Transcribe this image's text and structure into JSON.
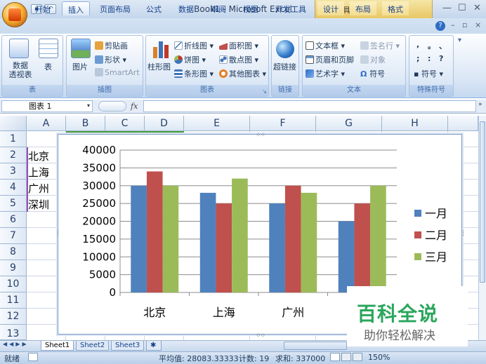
{
  "title_bar": {
    "app_title": "Book1 - Microsoft Excel",
    "context_tab_title": "图表工具",
    "quick_access": [
      "save",
      "undo",
      "redo"
    ]
  },
  "ribbon_tabs": [
    "开始",
    "插入",
    "页面布局",
    "公式",
    "数据",
    "审阅",
    "视图",
    "开发工具",
    "设计",
    "布局",
    "格式"
  ],
  "active_tab": "插入",
  "ribbon": {
    "table_group": {
      "label": "表",
      "pivot": "数据\n透视表",
      "table": "表"
    },
    "illustrations": {
      "label": "插图",
      "picture": "图片",
      "clipart": "剪贴画",
      "shapes": "形状",
      "smartart": "SmartArt"
    },
    "charts": {
      "label": "图表",
      "column": "柱形图",
      "line": "折线图",
      "pie": "饼图",
      "bar": "条形图",
      "area": "面积图",
      "scatter": "散点图",
      "other": "其他图表"
    },
    "links": {
      "label": "链接",
      "hyperlink": "超链接"
    },
    "text": {
      "label": "文本",
      "textbox": "文本框",
      "header_footer": "页眉和页脚",
      "wordart": "艺术字",
      "signature": "签名行",
      "object": "对象",
      "symbol": "符号"
    },
    "special": {
      "label": "特殊符号",
      "symbol": "符号",
      "chars": [
        ",",
        "。",
        "、",
        ";",
        ":",
        "?"
      ]
    }
  },
  "formula_bar": {
    "name_box": "图表 1",
    "fx": "fx",
    "content": ""
  },
  "columns": [
    "A",
    "B",
    "C",
    "D",
    "E",
    "F",
    "G",
    "H"
  ],
  "rows": [
    "1",
    "2",
    "3",
    "4",
    "5",
    "6",
    "7",
    "8",
    "9",
    "10",
    "11",
    "12",
    "13"
  ],
  "cells": {
    "A2": "北京",
    "A3": "上海",
    "A4": "广州",
    "A5": "深圳"
  },
  "chart_data": {
    "type": "bar",
    "categories": [
      "北京",
      "上海",
      "广州",
      "深圳"
    ],
    "series": [
      {
        "name": "一月",
        "color": "#4f81bd",
        "values": [
          30000,
          28000,
          25000,
          20000
        ]
      },
      {
        "name": "二月",
        "color": "#c0504d",
        "values": [
          34000,
          25000,
          30000,
          25000
        ]
      },
      {
        "name": "三月",
        "color": "#9bbb59",
        "values": [
          30000,
          32000,
          28000,
          30000
        ]
      }
    ],
    "ylim": [
      0,
      40000
    ],
    "yticks": [
      "0",
      "5000",
      "10000",
      "15000",
      "20000",
      "25000",
      "30000",
      "35000",
      "40000"
    ],
    "grid": true,
    "legend": "right"
  },
  "sheet_tabs": [
    "Sheet1",
    "Sheet2",
    "Sheet3"
  ],
  "active_sheet": "Sheet1",
  "status_bar": {
    "mode": "就绪",
    "average": "平均值: 28083.33333",
    "count": "计数: 19",
    "sum": "求和: 337000",
    "zoom": "150%"
  },
  "watermark": {
    "title": "百科全说",
    "subtitle": "助你轻松解决"
  }
}
